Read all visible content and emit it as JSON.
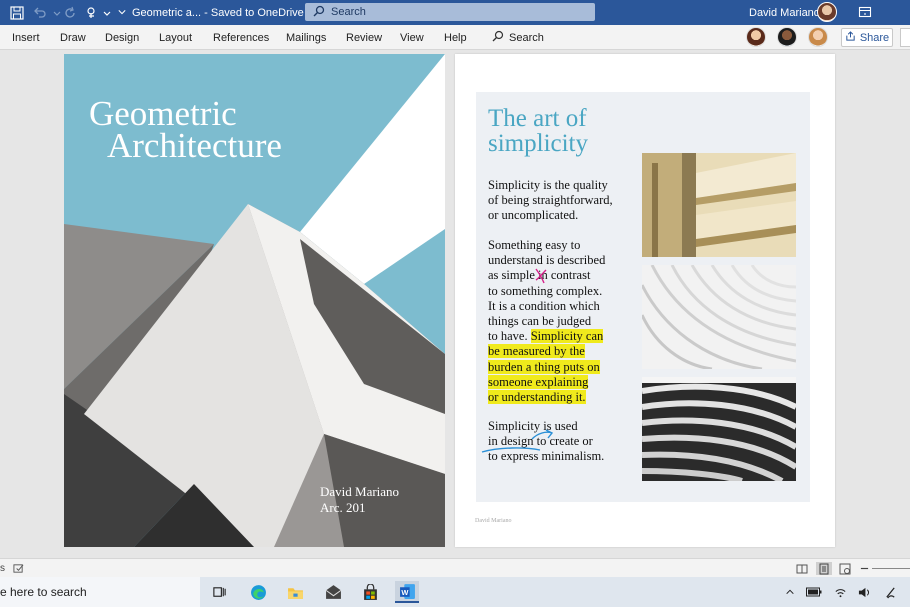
{
  "titlebar": {
    "doc_title": "Geometric a... - Saved to OneDrive",
    "search_placeholder": "Search",
    "user_name": "David Mariano"
  },
  "menu": {
    "items": [
      "Insert",
      "Draw",
      "Design",
      "Layout",
      "References",
      "Mailings",
      "Review",
      "View",
      "Help"
    ],
    "search_label": "Search",
    "share_label": "Share"
  },
  "cover": {
    "title_line1": "Geometric",
    "title_line2": "Architecture",
    "author": "David Mariano",
    "course": "Arc. 201"
  },
  "article": {
    "title_line1": "The art of",
    "title_line2": "simplicity",
    "para1": [
      "Simplicity is the quality",
      "of being straightforward,",
      "or uncomplicated."
    ],
    "para2_plain": [
      "Something easy to",
      "understand is described",
      "as simple in contrast",
      "to something complex.",
      "It is a condition which",
      "things can be judged"
    ],
    "para2_lead": "to have.",
    "para2_highlight": [
      "Simplicity can",
      "be measured by the",
      "burden a thing puts on",
      "someone explaining",
      "or understanding it."
    ],
    "para3": [
      "Simplicity is used",
      "in design to create or",
      "to express minimalism."
    ],
    "footer": "David Mariano"
  },
  "statusbar": {
    "left_label": "s"
  },
  "taskbar": {
    "search_text": "e here to search"
  },
  "colors": {
    "word_blue": "#2b579a",
    "accent_title": "#4aa6c3",
    "highlight": "#f0ea1c",
    "ink_pink": "#d6218a",
    "ink_blue": "#2a8fd6"
  }
}
